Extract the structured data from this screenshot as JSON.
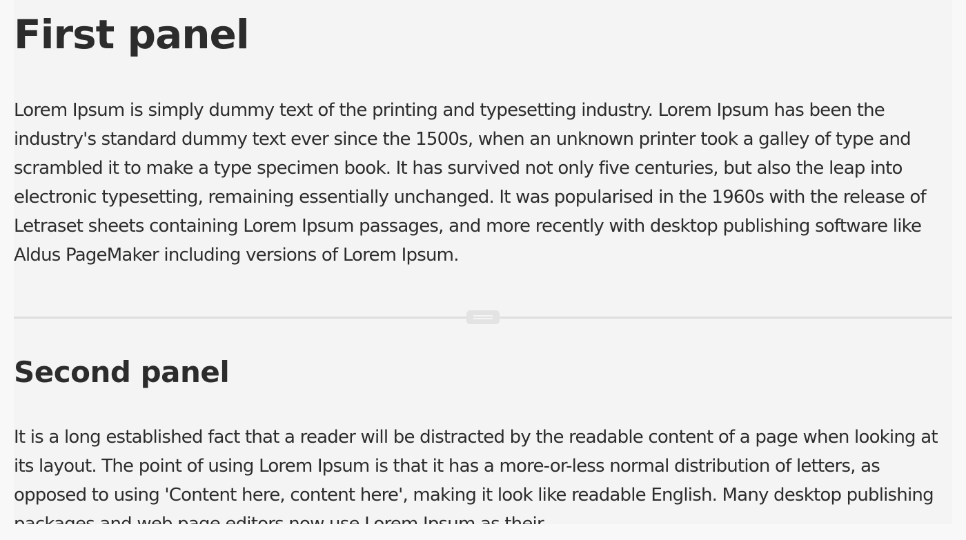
{
  "split_view": {
    "panels": [
      {
        "title": "First panel",
        "body": "Lorem Ipsum is simply dummy text of the printing and typesetting industry. Lorem Ipsum has been the industry's standard dummy text ever since the 1500s, when an unknown printer took a galley of type and scrambled it to make a type specimen book. It has survived not only five centuries, but also the leap into electronic typesetting, remaining essentially unchanged. It was popularised in the 1960s with the release of Letraset sheets containing Lorem Ipsum passages, and more recently with desktop publishing software like Aldus PageMaker including versions of Lorem Ipsum."
      },
      {
        "title": "Second panel",
        "body": "It is a long established fact that a reader will be distracted by the readable content of a page when looking at its layout. The point of using Lorem Ipsum is that it has a more-or-less normal distribution of letters, as opposed to using 'Content here, content here', making it look like readable English. Many desktop publishing packages and web page editors now use Lorem Ipsum as their"
      }
    ],
    "splitter": {
      "orientation": "horizontal",
      "handle_icon": "grip-handle-icon"
    }
  },
  "colors": {
    "page_background": "#f8f8f8",
    "panel_background": "#f4f4f4",
    "text": "#2c2c2c",
    "divider": "#dedede",
    "handle": "#e3e3e3"
  }
}
